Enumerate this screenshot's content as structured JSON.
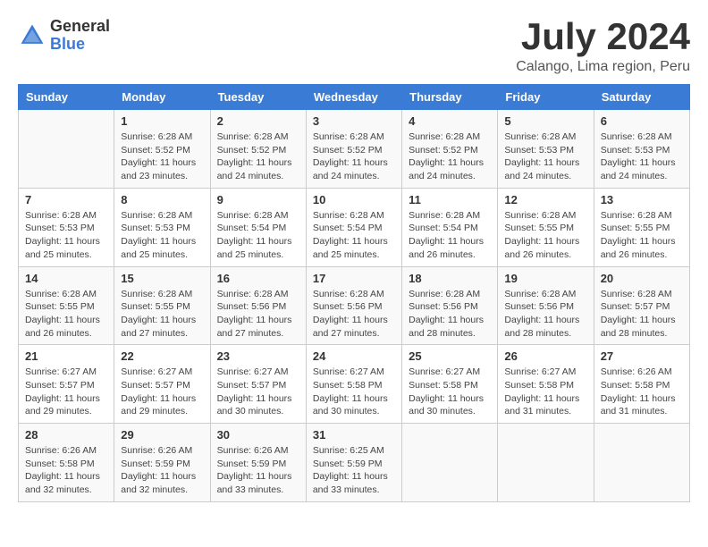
{
  "logo": {
    "general": "General",
    "blue": "Blue"
  },
  "title": "July 2024",
  "subtitle": "Calango, Lima region, Peru",
  "days_of_week": [
    "Sunday",
    "Monday",
    "Tuesday",
    "Wednesday",
    "Thursday",
    "Friday",
    "Saturday"
  ],
  "weeks": [
    [
      {
        "day": "",
        "info": ""
      },
      {
        "day": "1",
        "info": "Sunrise: 6:28 AM\nSunset: 5:52 PM\nDaylight: 11 hours and 23 minutes."
      },
      {
        "day": "2",
        "info": "Sunrise: 6:28 AM\nSunset: 5:52 PM\nDaylight: 11 hours and 24 minutes."
      },
      {
        "day": "3",
        "info": "Sunrise: 6:28 AM\nSunset: 5:52 PM\nDaylight: 11 hours and 24 minutes."
      },
      {
        "day": "4",
        "info": "Sunrise: 6:28 AM\nSunset: 5:52 PM\nDaylight: 11 hours and 24 minutes."
      },
      {
        "day": "5",
        "info": "Sunrise: 6:28 AM\nSunset: 5:53 PM\nDaylight: 11 hours and 24 minutes."
      },
      {
        "day": "6",
        "info": "Sunrise: 6:28 AM\nSunset: 5:53 PM\nDaylight: 11 hours and 24 minutes."
      }
    ],
    [
      {
        "day": "7",
        "info": "Sunrise: 6:28 AM\nSunset: 5:53 PM\nDaylight: 11 hours and 25 minutes."
      },
      {
        "day": "8",
        "info": "Sunrise: 6:28 AM\nSunset: 5:53 PM\nDaylight: 11 hours and 25 minutes."
      },
      {
        "day": "9",
        "info": "Sunrise: 6:28 AM\nSunset: 5:54 PM\nDaylight: 11 hours and 25 minutes."
      },
      {
        "day": "10",
        "info": "Sunrise: 6:28 AM\nSunset: 5:54 PM\nDaylight: 11 hours and 25 minutes."
      },
      {
        "day": "11",
        "info": "Sunrise: 6:28 AM\nSunset: 5:54 PM\nDaylight: 11 hours and 26 minutes."
      },
      {
        "day": "12",
        "info": "Sunrise: 6:28 AM\nSunset: 5:55 PM\nDaylight: 11 hours and 26 minutes."
      },
      {
        "day": "13",
        "info": "Sunrise: 6:28 AM\nSunset: 5:55 PM\nDaylight: 11 hours and 26 minutes."
      }
    ],
    [
      {
        "day": "14",
        "info": "Sunrise: 6:28 AM\nSunset: 5:55 PM\nDaylight: 11 hours and 26 minutes."
      },
      {
        "day": "15",
        "info": "Sunrise: 6:28 AM\nSunset: 5:55 PM\nDaylight: 11 hours and 27 minutes."
      },
      {
        "day": "16",
        "info": "Sunrise: 6:28 AM\nSunset: 5:56 PM\nDaylight: 11 hours and 27 minutes."
      },
      {
        "day": "17",
        "info": "Sunrise: 6:28 AM\nSunset: 5:56 PM\nDaylight: 11 hours and 27 minutes."
      },
      {
        "day": "18",
        "info": "Sunrise: 6:28 AM\nSunset: 5:56 PM\nDaylight: 11 hours and 28 minutes."
      },
      {
        "day": "19",
        "info": "Sunrise: 6:28 AM\nSunset: 5:56 PM\nDaylight: 11 hours and 28 minutes."
      },
      {
        "day": "20",
        "info": "Sunrise: 6:28 AM\nSunset: 5:57 PM\nDaylight: 11 hours and 28 minutes."
      }
    ],
    [
      {
        "day": "21",
        "info": "Sunrise: 6:27 AM\nSunset: 5:57 PM\nDaylight: 11 hours and 29 minutes."
      },
      {
        "day": "22",
        "info": "Sunrise: 6:27 AM\nSunset: 5:57 PM\nDaylight: 11 hours and 29 minutes."
      },
      {
        "day": "23",
        "info": "Sunrise: 6:27 AM\nSunset: 5:57 PM\nDaylight: 11 hours and 30 minutes."
      },
      {
        "day": "24",
        "info": "Sunrise: 6:27 AM\nSunset: 5:58 PM\nDaylight: 11 hours and 30 minutes."
      },
      {
        "day": "25",
        "info": "Sunrise: 6:27 AM\nSunset: 5:58 PM\nDaylight: 11 hours and 30 minutes."
      },
      {
        "day": "26",
        "info": "Sunrise: 6:27 AM\nSunset: 5:58 PM\nDaylight: 11 hours and 31 minutes."
      },
      {
        "day": "27",
        "info": "Sunrise: 6:26 AM\nSunset: 5:58 PM\nDaylight: 11 hours and 31 minutes."
      }
    ],
    [
      {
        "day": "28",
        "info": "Sunrise: 6:26 AM\nSunset: 5:58 PM\nDaylight: 11 hours and 32 minutes."
      },
      {
        "day": "29",
        "info": "Sunrise: 6:26 AM\nSunset: 5:59 PM\nDaylight: 11 hours and 32 minutes."
      },
      {
        "day": "30",
        "info": "Sunrise: 6:26 AM\nSunset: 5:59 PM\nDaylight: 11 hours and 33 minutes."
      },
      {
        "day": "31",
        "info": "Sunrise: 6:25 AM\nSunset: 5:59 PM\nDaylight: 11 hours and 33 minutes."
      },
      {
        "day": "",
        "info": ""
      },
      {
        "day": "",
        "info": ""
      },
      {
        "day": "",
        "info": ""
      }
    ]
  ]
}
